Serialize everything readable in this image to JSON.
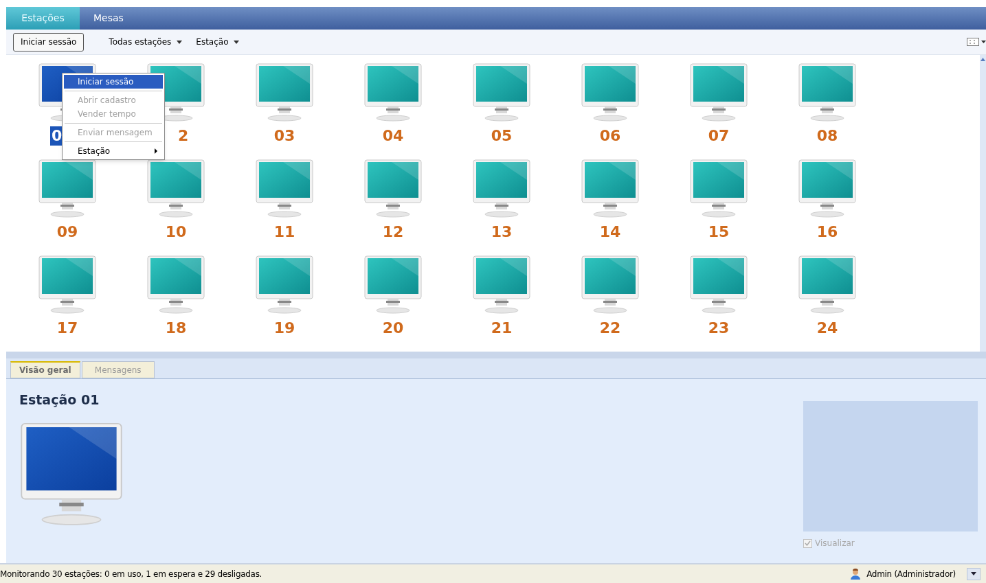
{
  "top_tabs": [
    {
      "label": "Estações",
      "selected": true
    },
    {
      "label": "Mesas",
      "selected": false
    }
  ],
  "toolbar": {
    "button": "Iniciar sessão",
    "menus": [
      "Todas estações",
      "Estação"
    ]
  },
  "stations": [
    {
      "label": "0",
      "selected": true,
      "kind": "head"
    },
    {
      "label": "2",
      "selected": false,
      "kind": "tail"
    },
    {
      "label": "03",
      "selected": false
    },
    {
      "label": "04",
      "selected": false
    },
    {
      "label": "05",
      "selected": false
    },
    {
      "label": "06",
      "selected": false
    },
    {
      "label": "07",
      "selected": false
    },
    {
      "label": "08",
      "selected": false
    },
    {
      "label": "09",
      "selected": false
    },
    {
      "label": "10",
      "selected": false
    },
    {
      "label": "11",
      "selected": false
    },
    {
      "label": "12",
      "selected": false
    },
    {
      "label": "13",
      "selected": false
    },
    {
      "label": "14",
      "selected": false
    },
    {
      "label": "15",
      "selected": false
    },
    {
      "label": "16",
      "selected": false
    },
    {
      "label": "17",
      "selected": false
    },
    {
      "label": "18",
      "selected": false
    },
    {
      "label": "19",
      "selected": false
    },
    {
      "label": "20",
      "selected": false
    },
    {
      "label": "21",
      "selected": false
    },
    {
      "label": "22",
      "selected": false
    },
    {
      "label": "23",
      "selected": false
    },
    {
      "label": "24",
      "selected": false
    }
  ],
  "context_menu": [
    {
      "kind": "item",
      "label": "Iniciar sessão",
      "selected": true,
      "disabled": false
    },
    {
      "kind": "separator"
    },
    {
      "kind": "item",
      "label": "Abrir cadastro",
      "selected": false,
      "disabled": true
    },
    {
      "kind": "item",
      "label": "Vender tempo",
      "selected": false,
      "disabled": true
    },
    {
      "kind": "separator"
    },
    {
      "kind": "item",
      "label": "Enviar mensagem",
      "selected": false,
      "disabled": true
    },
    {
      "kind": "separator"
    },
    {
      "kind": "submenu",
      "label": "Estação",
      "selected": false,
      "disabled": false
    }
  ],
  "detail_tabs": [
    {
      "label": "Visão geral",
      "selected": true
    },
    {
      "label": "Mensagens",
      "selected": false
    }
  ],
  "detail": {
    "title": "Estação 01",
    "preview_checkbox": {
      "label": "Visualizar",
      "checked": true,
      "disabled": true
    }
  },
  "status_bar": {
    "text": "Monitorando 30 estações: 0 em uso, 1 em espera e 29 desligadas.",
    "user": "Admin (Administrador)"
  }
}
